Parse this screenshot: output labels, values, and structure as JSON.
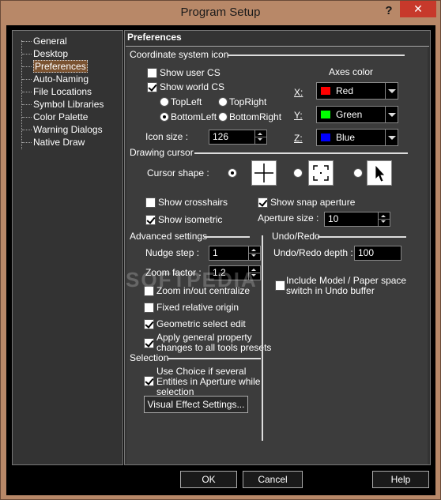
{
  "window": {
    "title": "Program Setup",
    "help_glyph": "?",
    "close_glyph": "✕"
  },
  "tree": {
    "items": [
      {
        "label": "General"
      },
      {
        "label": "Desktop"
      },
      {
        "label": "Preferences",
        "selected": true
      },
      {
        "label": "Auto-Naming"
      },
      {
        "label": "File Locations"
      },
      {
        "label": "Symbol Libraries"
      },
      {
        "label": "Color Palette"
      },
      {
        "label": "Warning Dialogs"
      },
      {
        "label": "Native Draw"
      }
    ]
  },
  "preferences": {
    "header": "Preferences",
    "coord": {
      "group_title": "Coordinate system icon",
      "show_user_cs": {
        "label": "Show user CS",
        "checked": false
      },
      "show_world_cs": {
        "label": "Show world CS",
        "checked": true
      },
      "positions": {
        "top_left": {
          "label": "TopLeft",
          "checked": false
        },
        "top_right": {
          "label": "TopRight",
          "checked": false
        },
        "bottom_left": {
          "label": "BottomLeft",
          "checked": true
        },
        "bottom_right": {
          "label": "BottomRight",
          "checked": false
        }
      },
      "icon_size": {
        "label": "Icon size :",
        "value": "126"
      },
      "axes_color": {
        "title": "Axes color",
        "x": {
          "label": "X:",
          "value": "Red",
          "color": "#ff0000"
        },
        "y": {
          "label": "Y:",
          "value": "Green",
          "color": "#00ff00"
        },
        "z": {
          "label": "Z:",
          "value": "Blue",
          "color": "#0000ff"
        }
      }
    },
    "drawing_cursor": {
      "group_title": "Drawing cursor",
      "cursor_shape_label": "Cursor shape :",
      "shapes": [
        {
          "name": "crosshair",
          "checked": true
        },
        {
          "name": "aperture-box",
          "checked": false
        },
        {
          "name": "arrow",
          "checked": false
        }
      ],
      "show_crosshairs": {
        "label": "Show crosshairs",
        "checked": false
      },
      "show_snap_aperture": {
        "label": "Show snap aperture",
        "checked": true
      },
      "show_isometric": {
        "label": "Show isometric",
        "checked": true
      },
      "aperture_size": {
        "label": "Aperture size :",
        "value": "10"
      }
    },
    "advanced": {
      "group_title": "Advanced settings",
      "nudge_step": {
        "label": "Nudge step :",
        "value": "1"
      },
      "zoom_factor": {
        "label": "Zoom factor :",
        "value": "1.2"
      },
      "zoom_centralize": {
        "label": "Zoom in/out centralize",
        "checked": false
      },
      "fixed_origin": {
        "label": "Fixed relative origin",
        "checked": false
      },
      "geometric_select": {
        "label": "Geometric select edit",
        "checked": true
      },
      "apply_general": {
        "line1": "Apply general property",
        "line2": "changes to all tools presets",
        "checked": true
      }
    },
    "undo": {
      "group_title": "Undo/Redo",
      "depth": {
        "label": "Undo/Redo depth :",
        "value": "100"
      },
      "include_model": {
        "line1": "Include Model / Paper space",
        "line2": "switch in Undo buffer",
        "checked": false
      }
    },
    "selection": {
      "group_title": "Selection",
      "use_choice": {
        "line1": "Use Choice if several",
        "line2": "Entities in Aperture while",
        "line3": "selection",
        "checked": true
      },
      "visual_effect_button": "Visual Effect Settings..."
    }
  },
  "buttons": {
    "ok": "OK",
    "cancel": "Cancel",
    "help": "Help"
  },
  "watermark": "SOFTPEDIA"
}
